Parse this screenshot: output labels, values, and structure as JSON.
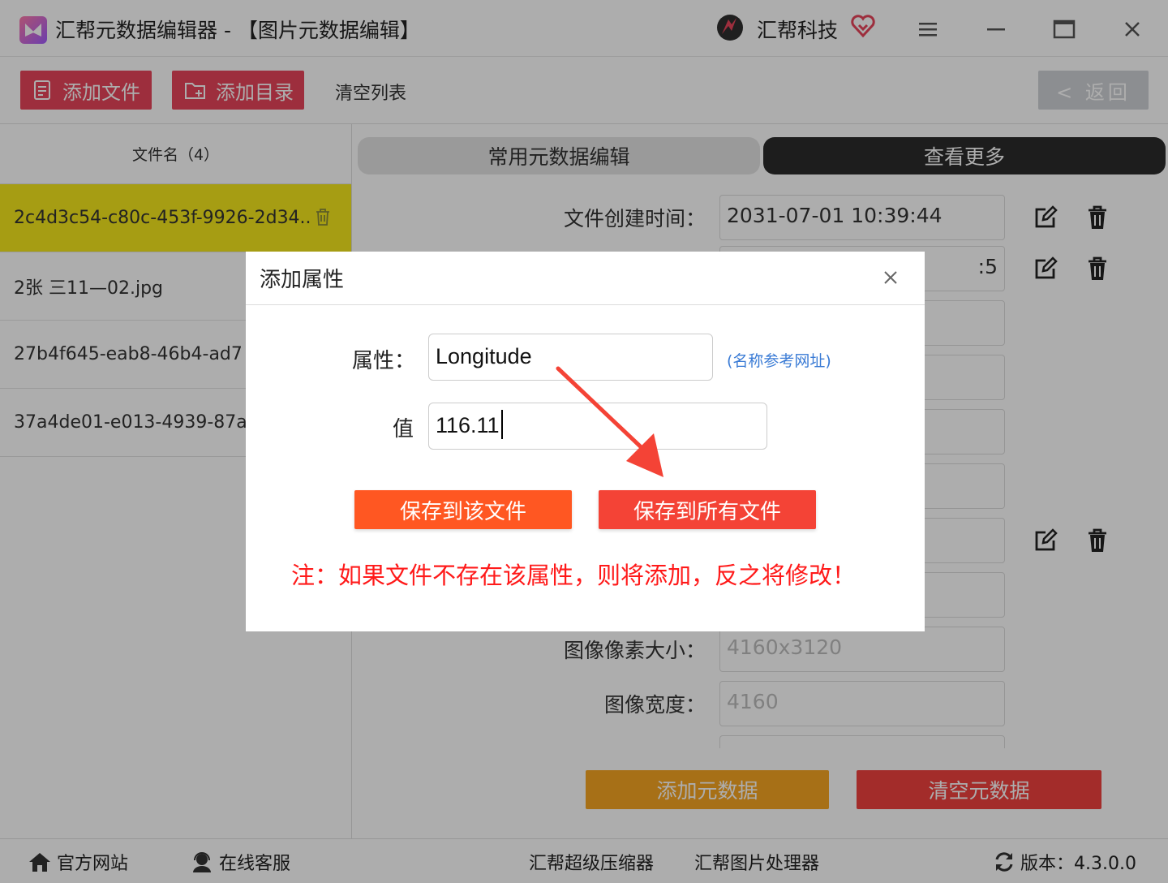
{
  "titlebar": {
    "app_title": "汇帮元数据编辑器 - 【图片元数据编辑】",
    "brand_name": "汇帮科技",
    "menu_icon": "hamburger-icon",
    "minimize_icon": "minimize-icon",
    "maximize_icon": "maximize-icon",
    "close_icon": "close-icon"
  },
  "toolbar": {
    "add_file": "添加文件",
    "add_folder": "添加目录",
    "clear_list": "清空列表",
    "back": "< 返回"
  },
  "file_list": {
    "header": "文件名（4）",
    "files": [
      {
        "name": "2c4d3c54-c80c-453f-9926-2d34..",
        "selected": true
      },
      {
        "name": "2张 三11—02.jpg",
        "selected": false
      },
      {
        "name": "27b4f645-eab8-46b4-ad7",
        "selected": false
      },
      {
        "name": "37a4de01-e013-4939-87a",
        "selected": false
      }
    ]
  },
  "tabs": {
    "common": "常用元数据编辑",
    "more": "查看更多"
  },
  "metadata": {
    "rows": [
      {
        "label": "文件创建时间：",
        "value": "2031-07-01 10:39:44"
      },
      {
        "label": "",
        "value": ":5"
      },
      {
        "label": "图像像素大小：",
        "value": "4160x3120"
      },
      {
        "label": "图像宽度：",
        "value": "4160"
      }
    ],
    "add_button": "添加元数据",
    "clear_button": "清空元数据"
  },
  "dialog": {
    "title": "添加属性",
    "attr_label": "属性：",
    "attr_value": "Longitude",
    "value_label": "值",
    "value_value": "116.11",
    "ref_link": "(名称参考网址)",
    "save_one": "保存到该文件",
    "save_all": "保存到所有文件",
    "note": "注：如果文件不存在该属性，则将添加，反之将修改！"
  },
  "footer": {
    "website": "官方网站",
    "service": "在线客服",
    "compressor": "汇帮超级压缩器",
    "image_processor": "汇帮图片处理器",
    "version": "版本：4.3.0.0"
  },
  "colors": {
    "pink_button": "#e8455a",
    "selected_row": "#f5e81c",
    "save_one": "#ff5722",
    "save_all": "#f44336",
    "note_red": "#ff1a1a",
    "link_blue": "#3a7bd5",
    "add_meta": "#f6a623",
    "clear_meta": "#f0413e"
  }
}
